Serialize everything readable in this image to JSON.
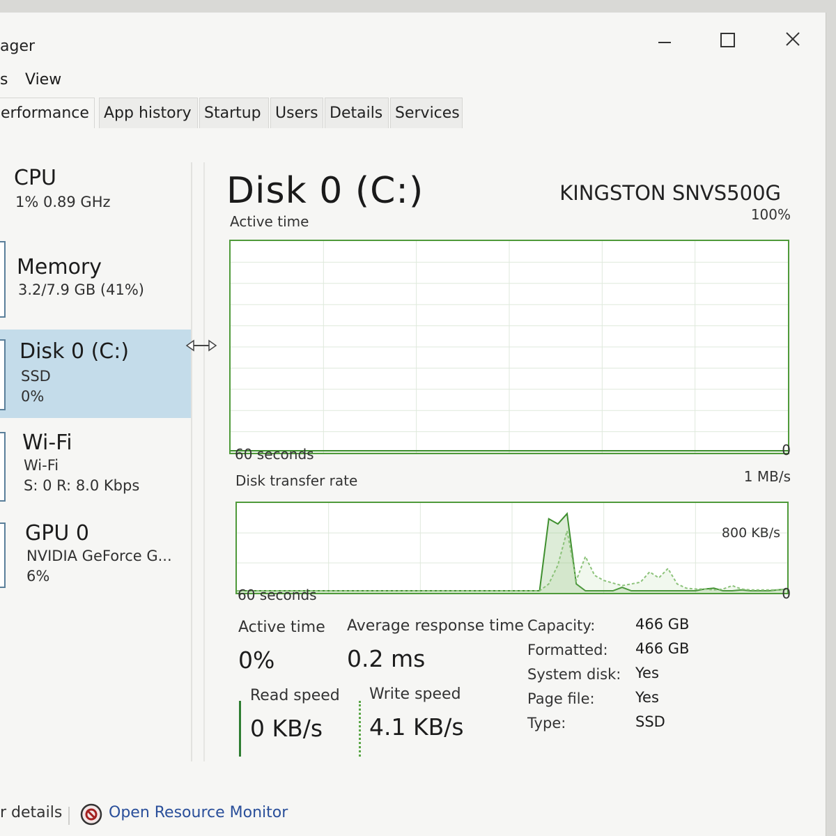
{
  "window": {
    "title": "ager"
  },
  "menu": {
    "items": [
      "s",
      "View"
    ]
  },
  "tabs": [
    {
      "label": "erformance",
      "active": true
    },
    {
      "label": "App history"
    },
    {
      "label": "Startup"
    },
    {
      "label": "Users"
    },
    {
      "label": "Details"
    },
    {
      "label": "Services"
    }
  ],
  "sidebar": {
    "items": [
      {
        "name": "CPU",
        "lines": [
          "1% 0.89 GHz"
        ]
      },
      {
        "name": "Memory",
        "lines": [
          "3.2/7.9 GB (41%)"
        ]
      },
      {
        "name": "Disk 0 (C:)",
        "lines": [
          "SSD",
          "0%"
        ],
        "selected": true
      },
      {
        "name": "Wi-Fi",
        "lines": [
          "Wi-Fi",
          "S: 0 R: 8.0 Kbps"
        ]
      },
      {
        "name": "GPU 0",
        "lines": [
          "NVIDIA GeForce G...",
          "6%"
        ]
      }
    ]
  },
  "detail": {
    "title": "Disk 0 (C:)",
    "model": "KINGSTON SNVS500G",
    "chart1": {
      "label": "Active time",
      "max": "100%",
      "time": "60 seconds",
      "min": "0"
    },
    "chart2": {
      "label": "Disk transfer rate",
      "max": "1 MB/s",
      "mid": "800 KB/s",
      "time": "60 seconds",
      "min": "0"
    },
    "stats": {
      "active_time_label": "Active time",
      "active_time_value": "0%",
      "avg_response_label": "Average response time",
      "avg_response_value": "0.2 ms",
      "read_label": "Read speed",
      "read_value": "0 KB/s",
      "write_label": "Write speed",
      "write_value": "4.1 KB/s"
    },
    "properties": [
      {
        "key": "Capacity:",
        "value": "466 GB"
      },
      {
        "key": "Formatted:",
        "value": "466 GB"
      },
      {
        "key": "System disk:",
        "value": "Yes"
      },
      {
        "key": "Page file:",
        "value": "Yes"
      },
      {
        "key": "Type:",
        "value": "SSD"
      }
    ]
  },
  "footer": {
    "details_label": "r details",
    "resource_monitor_label": "Open Resource Monitor"
  },
  "colors": {
    "accent_green": "#4f9a3a",
    "selection_blue": "#c4dcea",
    "link_blue": "#2a4f9a"
  },
  "chart_data": {
    "type": "line",
    "charts": [
      {
        "name": "Active time",
        "x_range_seconds": [
          0,
          60
        ],
        "ylim": [
          0,
          100
        ],
        "y_unit": "%",
        "series": [
          {
            "values": [
              0,
              0,
              0,
              0,
              0,
              0,
              0,
              0,
              0,
              0,
              0,
              0,
              0,
              0,
              0,
              0,
              0,
              0,
              0,
              0,
              0,
              0,
              0,
              0,
              0,
              0,
              0,
              0,
              0,
              0,
              0,
              0,
              0,
              0,
              0,
              0,
              0,
              0,
              0,
              0,
              0,
              0,
              0,
              0,
              0,
              0,
              0,
              0,
              0,
              0,
              0,
              0,
              0,
              0,
              0,
              0,
              0,
              0,
              0,
              0,
              0
            ]
          }
        ]
      },
      {
        "name": "Disk transfer rate",
        "x_range_seconds": [
          0,
          60
        ],
        "ylim": [
          0,
          1000
        ],
        "y_unit": "KB/s",
        "series": [
          {
            "values": [
              0,
              0,
              0,
              0,
              0,
              0,
              0,
              0,
              0,
              0,
              0,
              0,
              0,
              0,
              0,
              0,
              0,
              0,
              0,
              0,
              0,
              0,
              0,
              0,
              0,
              0,
              0,
              0,
              0,
              0,
              0,
              0,
              0,
              0,
              840,
              780,
              900,
              80,
              0,
              0,
              0,
              0,
              40,
              0,
              0,
              0,
              0,
              0,
              0,
              0,
              0,
              20,
              30,
              0,
              0,
              10,
              0,
              0,
              0,
              10,
              20
            ]
          },
          {
            "values": [
              0,
              0,
              0,
              0,
              0,
              0,
              0,
              0,
              0,
              0,
              0,
              0,
              0,
              0,
              0,
              0,
              0,
              0,
              0,
              0,
              0,
              0,
              0,
              0,
              0,
              0,
              0,
              0,
              0,
              0,
              0,
              0,
              0,
              0,
              80,
              300,
              700,
              120,
              400,
              180,
              120,
              90,
              60,
              80,
              100,
              220,
              150,
              260,
              80,
              30,
              20,
              20,
              10,
              20,
              60,
              20,
              10,
              10,
              10,
              10,
              20
            ]
          }
        ]
      }
    ]
  }
}
